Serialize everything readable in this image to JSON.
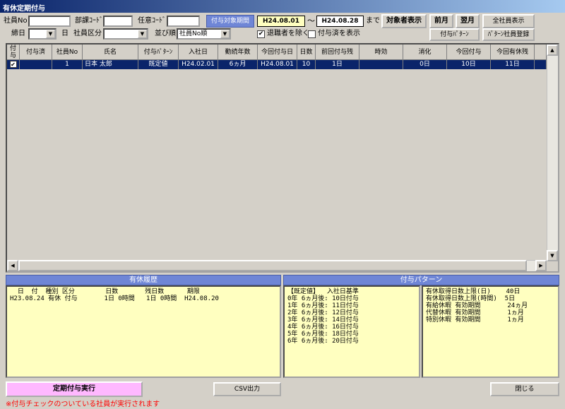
{
  "window": {
    "title": "有休定期付与"
  },
  "filters": {
    "emp_no_label": "社員No",
    "dept_code_label": "部課ｺｰﾄﾞ",
    "any_code_label": "任意ｺｰﾄﾞ",
    "close_day_label": "締日",
    "close_day_suffix": "日",
    "emp_class_label": "社員区分",
    "sort_label": "並び順",
    "sort_value": "社員No順",
    "period_label": "付与対象期間",
    "period_from": "H24.08.01",
    "period_sep": "～",
    "period_to": "H24.08.28",
    "period_until": "まで",
    "exclude_retired_label": "退職者を除く",
    "show_granted_label": "付与済を表示"
  },
  "buttons": {
    "show_target": "対象者表示",
    "prev_month": "前月",
    "next_month": "翌月",
    "show_all": "全社員表示",
    "grant_pattern": "付与ﾊﾟﾀｰﾝ",
    "pattern_register": "ﾊﾟﾀｰﾝ社員登録",
    "execute": "定期付与実行",
    "csv": "CSV出力",
    "close": "閉じる"
  },
  "grid": {
    "headers": [
      "付与",
      "付与済",
      "社員No",
      "氏名",
      "付与ﾊﾟﾀｰﾝ",
      "入社日",
      "勤続年数",
      "今回付与日",
      "日数",
      "前回付与残",
      "時効",
      "消化",
      "今回付与",
      "今回有休残"
    ],
    "rows": [
      {
        "grant": "✔",
        "granted": "",
        "emp_no": "1",
        "name": "日本 太郎",
        "pattern": "既定値",
        "hire_date": "H24.02.01",
        "tenure": "6ヵ月",
        "grant_date": "H24.08.01",
        "days": "10",
        "prev_remain": "1日",
        "expiry": "",
        "used": "0日",
        "this_grant": "10日",
        "this_remain": "11日"
      }
    ]
  },
  "history": {
    "title": "有休履歴",
    "header": "  日  付  種別 区分        日数       残日数      期限",
    "row": "H23.08.24 有休 付与       1日 0時間   1日 0時間  H24.08.20"
  },
  "pattern": {
    "title": "付与パターン",
    "left_lines": [
      "【既定値】  入社日基準",
      "0年 6ヵ月後: 10日付与",
      "1年 6ヵ月後: 11日付与",
      "2年 6ヵ月後: 12日付与",
      "3年 6ヵ月後: 14日付与",
      "4年 6ヵ月後: 16日付与",
      "5年 6ヵ月後: 18日付与",
      "6年 6ヵ月後: 20日付与"
    ],
    "right_lines": [
      "有休取得日数上限(日)    40日",
      "有休取得日数上限(時間)  5日",
      "有給休暇 有効期間       24ヵ月",
      "代替休暇 有効期間       1ヵ月",
      "特別休暇 有効期間       1ヵ月"
    ]
  },
  "footer": {
    "note": "※付与チェックのついている社員が実行されます"
  }
}
